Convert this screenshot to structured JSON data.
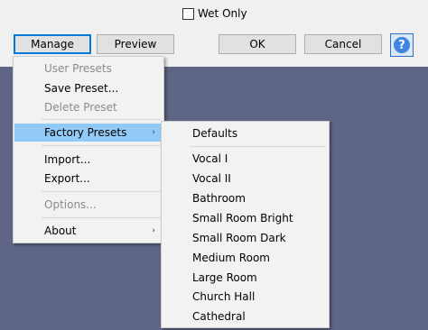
{
  "toolbar": {
    "wet_only_label": "Wet Only",
    "wet_only_checked": false,
    "manage_label": "Manage",
    "preview_label": "Preview",
    "ok_label": "OK",
    "cancel_label": "Cancel",
    "help_glyph": "?"
  },
  "manage_menu": {
    "items": [
      {
        "label": "User Presets",
        "enabled": false
      },
      {
        "label": "Save Preset...",
        "enabled": true
      },
      {
        "label": "Delete Preset",
        "enabled": false
      },
      {
        "label": "Factory Presets",
        "enabled": true,
        "highlighted": true,
        "submenu": true
      },
      {
        "label": "Import...",
        "enabled": true
      },
      {
        "label": "Export...",
        "enabled": true
      },
      {
        "label": "Options...",
        "enabled": false
      },
      {
        "label": "About",
        "enabled": true,
        "submenu": true
      }
    ],
    "arrow_glyph": "›"
  },
  "factory_presets_menu": {
    "items": [
      "Defaults",
      "Vocal I",
      "Vocal II",
      "Bathroom",
      "Small Room Bright",
      "Small Room Dark",
      "Medium Room",
      "Large Room",
      "Church Hall",
      "Cathedral"
    ]
  },
  "colors": {
    "background": "#5f6585",
    "highlight": "#91c9f7",
    "focus_border": "#0078d7"
  }
}
